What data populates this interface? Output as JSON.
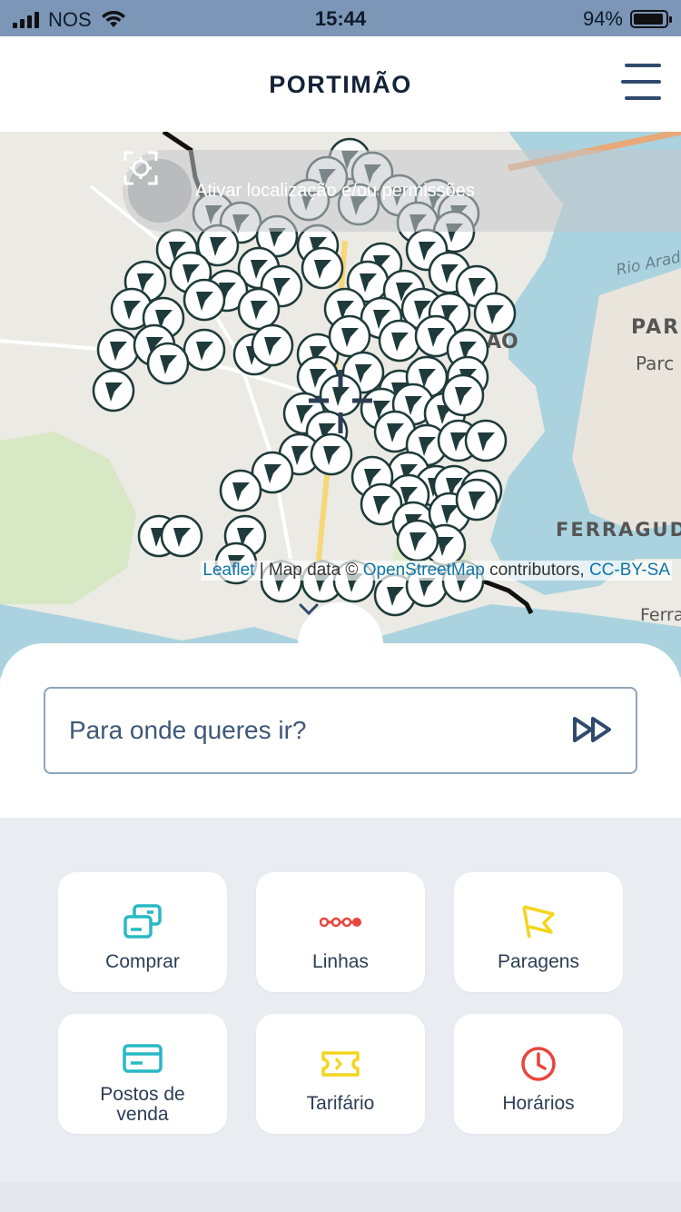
{
  "status_bar": {
    "carrier": "NOS",
    "time": "15:44",
    "battery": "94%",
    "battery_level": 0.94
  },
  "header": {
    "title": "PORTIMÃO",
    "menu_icon": "hamburger-menu-icon"
  },
  "map": {
    "location_banner_text": "Ativar localização e/ou permissões",
    "location_icon": "locate-crosshair-icon",
    "place_labels": [
      "PARC",
      "Parc",
      "Rio Arade",
      "FERRAGUD",
      "Ferra",
      "AO"
    ],
    "attribution": {
      "leaflet": "Leaflet",
      "separator": " | Map data © ",
      "osm": "OpenStreetMap",
      "contributors": " contributors, ",
      "license": "CC-BY-SA"
    },
    "marker_icon": "bus-stop-flag-icon",
    "collapse_icon": "chevron-down-icon"
  },
  "search": {
    "placeholder": "Para onde queres ir?",
    "go_icon": "fast-forward-icon"
  },
  "actions": [
    {
      "label": "Comprar",
      "icon": "ticket-cards-icon",
      "color": "#27b9c4"
    },
    {
      "label": "Linhas",
      "icon": "route-dots-icon",
      "color": "#e8453c"
    },
    {
      "label": "Paragens",
      "icon": "flag-icon",
      "color": "#f4d51d"
    },
    {
      "label": "Postos de venda",
      "icon": "credit-card-icon",
      "color": "#27b9c4"
    },
    {
      "label": "Tarifário",
      "icon": "ticket-icon",
      "color": "#f4d51d"
    },
    {
      "label": "Horários",
      "icon": "clock-icon",
      "color": "#e8453c"
    }
  ]
}
